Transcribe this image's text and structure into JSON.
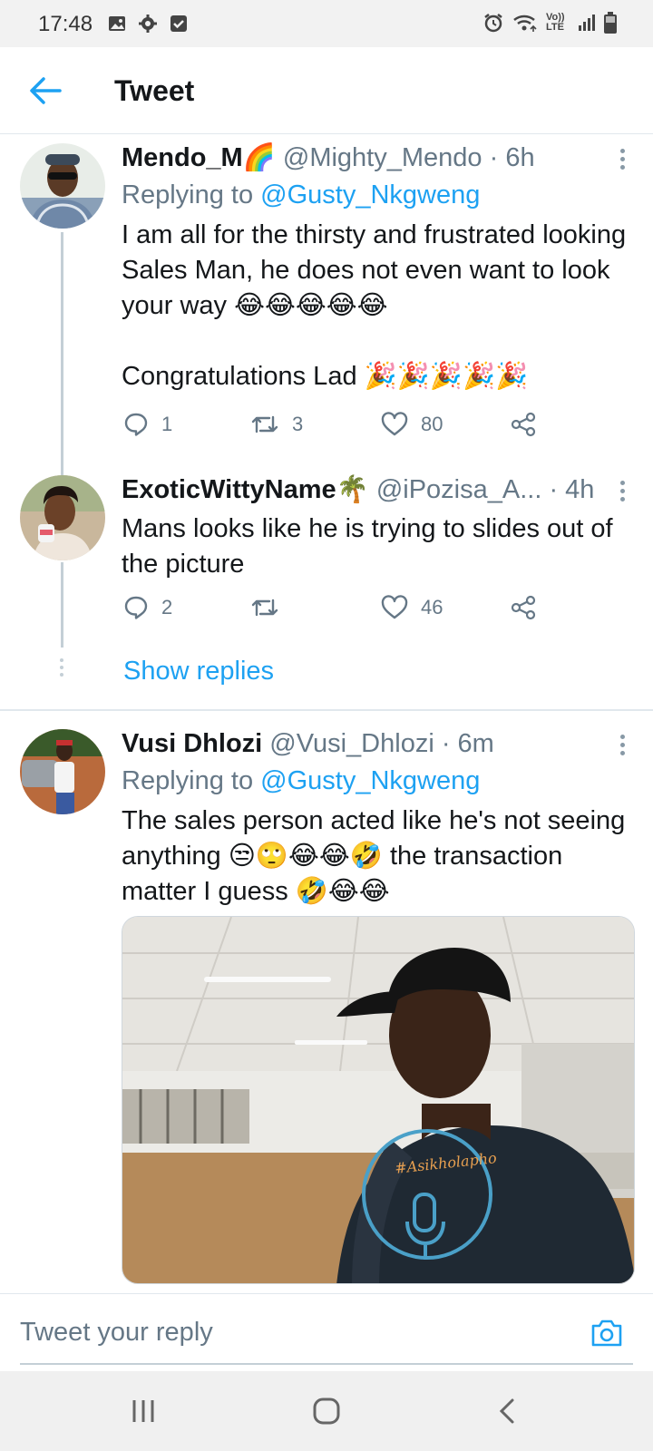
{
  "status_bar": {
    "time": "17:48",
    "left_icons": [
      "image-icon",
      "gear-icon",
      "checkbox-icon"
    ],
    "right_icons": [
      "alarm-icon",
      "wifi-icon",
      "volte-icon",
      "signal-icon",
      "battery-icon"
    ],
    "volte_label": "Vo)) LTE"
  },
  "header": {
    "title": "Tweet",
    "back_icon": "back-arrow-icon"
  },
  "tweets": [
    {
      "name": "Mendo_M🌈",
      "handle": "@Mighty_Mendo",
      "time": "· 6h",
      "replying_prefix": "Replying to",
      "replying_to": "@Gusty_Nkgweng",
      "text": "I am all for the thirsty and frustrated looking Sales Man, he does not even want to look your way 😂😂😂😂😂\n\nCongratulations Lad 🎉🎉🎉🎉🎉",
      "replies": "1",
      "retweets": "3",
      "likes": "80"
    },
    {
      "name": "ExoticWittyName🌴",
      "handle": "@iPozisa_A...",
      "time": "· 4h",
      "text": "Mans looks like he is trying to slides out of the picture",
      "replies": "2",
      "retweets": "",
      "likes": "46"
    },
    {
      "name": "Vusi Dhlozi",
      "handle": "@Vusi_Dhlozi",
      "time": "· 6m",
      "replying_prefix": "Replying to",
      "replying_to": "@Gusty_Nkgweng",
      "text": "The sales person acted like he's not seeing anything 😒🙄😂😂🤣 the transaction matter I guess 🤣😂😂",
      "media_shirt_text": "#Asikholapho"
    }
  ],
  "show_replies": "Show replies",
  "reply_bar": {
    "placeholder": "Tweet your reply",
    "camera_icon": "camera-icon"
  },
  "nav_bar": {
    "buttons": [
      "recent-apps-icon",
      "home-icon",
      "back-icon"
    ]
  },
  "colors": {
    "accent": "#1da1f2",
    "muted": "#657786",
    "text": "#14171a",
    "divider": "#e1e8ed"
  }
}
